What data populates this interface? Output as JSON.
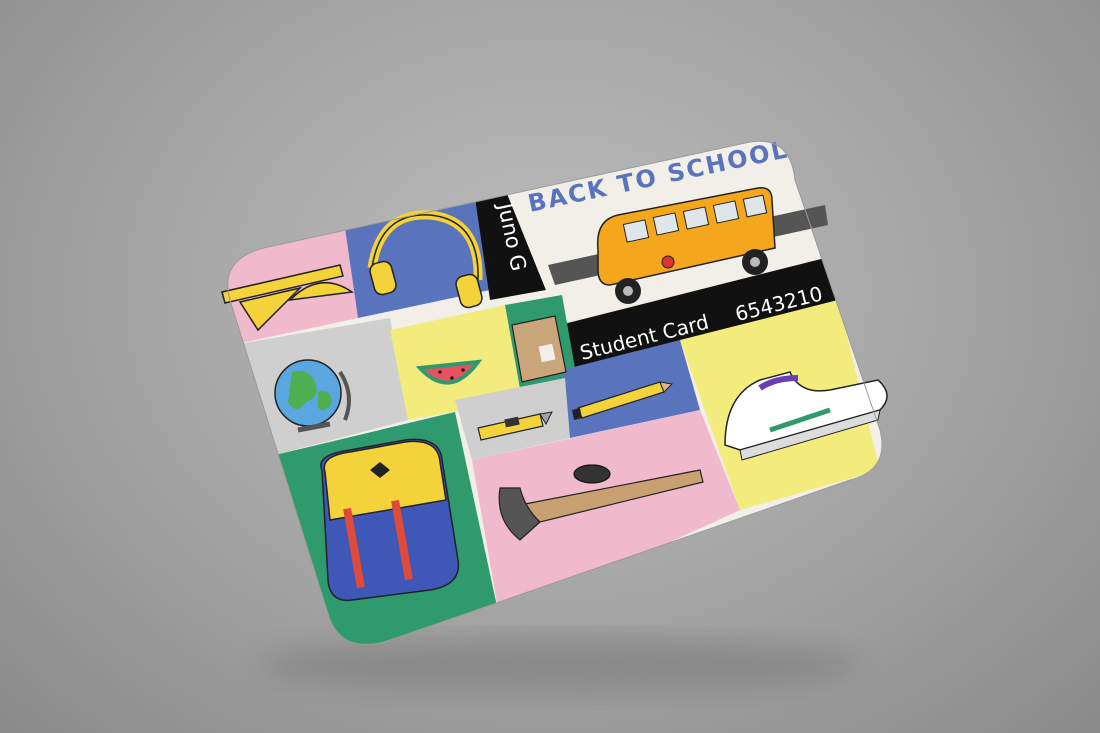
{
  "card": {
    "headline": "BACK TO SCHOOL",
    "holder_name": "Juno G",
    "card_label": "Student Card",
    "card_number": "6543210"
  },
  "palette": {
    "pink": "#f0b9cc",
    "blue": "#5a73bd",
    "yellow": "#f3ec7c",
    "grey": "#cfcfcf",
    "green": "#2f9a6e",
    "cream": "#f1efe8",
    "black": "#111111"
  },
  "icons": [
    "ruler-icon",
    "headphones-icon",
    "globe-icon",
    "watermelon-icon",
    "notebook-icon",
    "pencil-icon",
    "box-cutter-icon",
    "backpack-icon",
    "hockey-stick-icon",
    "puck-icon",
    "sneaker-icon",
    "school-bus-icon"
  ]
}
